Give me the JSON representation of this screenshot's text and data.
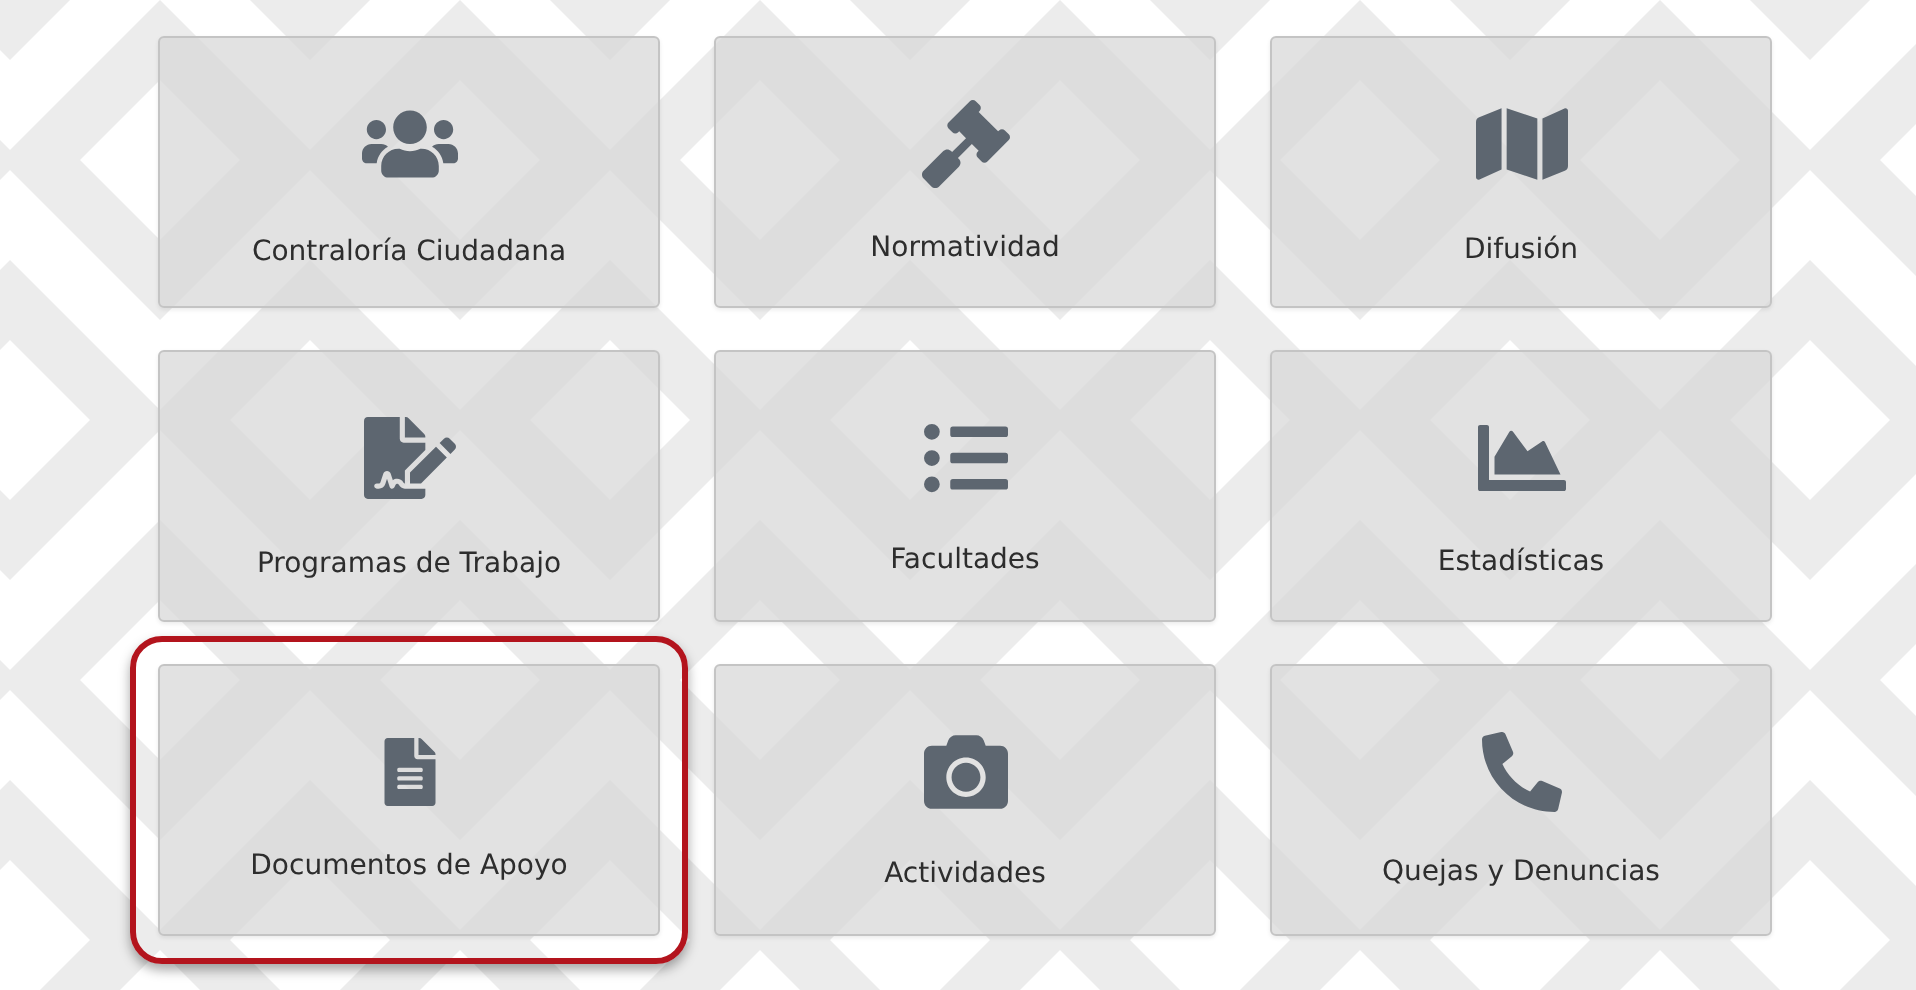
{
  "tiles": [
    {
      "label": "Contraloría Ciudadana",
      "kind": "users",
      "selected": false
    },
    {
      "label": "Normatividad",
      "kind": "gavel",
      "selected": false
    },
    {
      "label": "Difusión",
      "kind": "map",
      "selected": false
    },
    {
      "label": "Programas de Trabajo",
      "kind": "signature",
      "selected": false
    },
    {
      "label": "Facultades",
      "kind": "list",
      "selected": false
    },
    {
      "label": "Estadísticas",
      "kind": "chart",
      "selected": false
    },
    {
      "label": "Documentos de Apoyo",
      "kind": "document",
      "selected": true
    },
    {
      "label": "Actividades",
      "kind": "camera",
      "selected": false
    },
    {
      "label": "Quejas y Denuncias",
      "kind": "phone",
      "selected": false
    }
  ]
}
